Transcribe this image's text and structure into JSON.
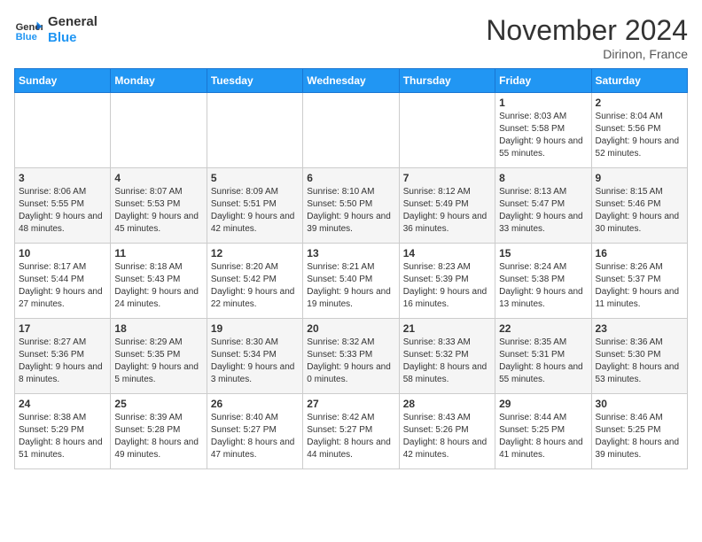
{
  "header": {
    "logo_line1": "General",
    "logo_line2": "Blue",
    "month_title": "November 2024",
    "location": "Dirinon, France"
  },
  "days_of_week": [
    "Sunday",
    "Monday",
    "Tuesday",
    "Wednesday",
    "Thursday",
    "Friday",
    "Saturday"
  ],
  "weeks": [
    [
      {
        "day": "",
        "info": ""
      },
      {
        "day": "",
        "info": ""
      },
      {
        "day": "",
        "info": ""
      },
      {
        "day": "",
        "info": ""
      },
      {
        "day": "",
        "info": ""
      },
      {
        "day": "1",
        "info": "Sunrise: 8:03 AM\nSunset: 5:58 PM\nDaylight: 9 hours and 55 minutes."
      },
      {
        "day": "2",
        "info": "Sunrise: 8:04 AM\nSunset: 5:56 PM\nDaylight: 9 hours and 52 minutes."
      }
    ],
    [
      {
        "day": "3",
        "info": "Sunrise: 8:06 AM\nSunset: 5:55 PM\nDaylight: 9 hours and 48 minutes."
      },
      {
        "day": "4",
        "info": "Sunrise: 8:07 AM\nSunset: 5:53 PM\nDaylight: 9 hours and 45 minutes."
      },
      {
        "day": "5",
        "info": "Sunrise: 8:09 AM\nSunset: 5:51 PM\nDaylight: 9 hours and 42 minutes."
      },
      {
        "day": "6",
        "info": "Sunrise: 8:10 AM\nSunset: 5:50 PM\nDaylight: 9 hours and 39 minutes."
      },
      {
        "day": "7",
        "info": "Sunrise: 8:12 AM\nSunset: 5:49 PM\nDaylight: 9 hours and 36 minutes."
      },
      {
        "day": "8",
        "info": "Sunrise: 8:13 AM\nSunset: 5:47 PM\nDaylight: 9 hours and 33 minutes."
      },
      {
        "day": "9",
        "info": "Sunrise: 8:15 AM\nSunset: 5:46 PM\nDaylight: 9 hours and 30 minutes."
      }
    ],
    [
      {
        "day": "10",
        "info": "Sunrise: 8:17 AM\nSunset: 5:44 PM\nDaylight: 9 hours and 27 minutes."
      },
      {
        "day": "11",
        "info": "Sunrise: 8:18 AM\nSunset: 5:43 PM\nDaylight: 9 hours and 24 minutes."
      },
      {
        "day": "12",
        "info": "Sunrise: 8:20 AM\nSunset: 5:42 PM\nDaylight: 9 hours and 22 minutes."
      },
      {
        "day": "13",
        "info": "Sunrise: 8:21 AM\nSunset: 5:40 PM\nDaylight: 9 hours and 19 minutes."
      },
      {
        "day": "14",
        "info": "Sunrise: 8:23 AM\nSunset: 5:39 PM\nDaylight: 9 hours and 16 minutes."
      },
      {
        "day": "15",
        "info": "Sunrise: 8:24 AM\nSunset: 5:38 PM\nDaylight: 9 hours and 13 minutes."
      },
      {
        "day": "16",
        "info": "Sunrise: 8:26 AM\nSunset: 5:37 PM\nDaylight: 9 hours and 11 minutes."
      }
    ],
    [
      {
        "day": "17",
        "info": "Sunrise: 8:27 AM\nSunset: 5:36 PM\nDaylight: 9 hours and 8 minutes."
      },
      {
        "day": "18",
        "info": "Sunrise: 8:29 AM\nSunset: 5:35 PM\nDaylight: 9 hours and 5 minutes."
      },
      {
        "day": "19",
        "info": "Sunrise: 8:30 AM\nSunset: 5:34 PM\nDaylight: 9 hours and 3 minutes."
      },
      {
        "day": "20",
        "info": "Sunrise: 8:32 AM\nSunset: 5:33 PM\nDaylight: 9 hours and 0 minutes."
      },
      {
        "day": "21",
        "info": "Sunrise: 8:33 AM\nSunset: 5:32 PM\nDaylight: 8 hours and 58 minutes."
      },
      {
        "day": "22",
        "info": "Sunrise: 8:35 AM\nSunset: 5:31 PM\nDaylight: 8 hours and 55 minutes."
      },
      {
        "day": "23",
        "info": "Sunrise: 8:36 AM\nSunset: 5:30 PM\nDaylight: 8 hours and 53 minutes."
      }
    ],
    [
      {
        "day": "24",
        "info": "Sunrise: 8:38 AM\nSunset: 5:29 PM\nDaylight: 8 hours and 51 minutes."
      },
      {
        "day": "25",
        "info": "Sunrise: 8:39 AM\nSunset: 5:28 PM\nDaylight: 8 hours and 49 minutes."
      },
      {
        "day": "26",
        "info": "Sunrise: 8:40 AM\nSunset: 5:27 PM\nDaylight: 8 hours and 47 minutes."
      },
      {
        "day": "27",
        "info": "Sunrise: 8:42 AM\nSunset: 5:27 PM\nDaylight: 8 hours and 44 minutes."
      },
      {
        "day": "28",
        "info": "Sunrise: 8:43 AM\nSunset: 5:26 PM\nDaylight: 8 hours and 42 minutes."
      },
      {
        "day": "29",
        "info": "Sunrise: 8:44 AM\nSunset: 5:25 PM\nDaylight: 8 hours and 41 minutes."
      },
      {
        "day": "30",
        "info": "Sunrise: 8:46 AM\nSunset: 5:25 PM\nDaylight: 8 hours and 39 minutes."
      }
    ]
  ]
}
